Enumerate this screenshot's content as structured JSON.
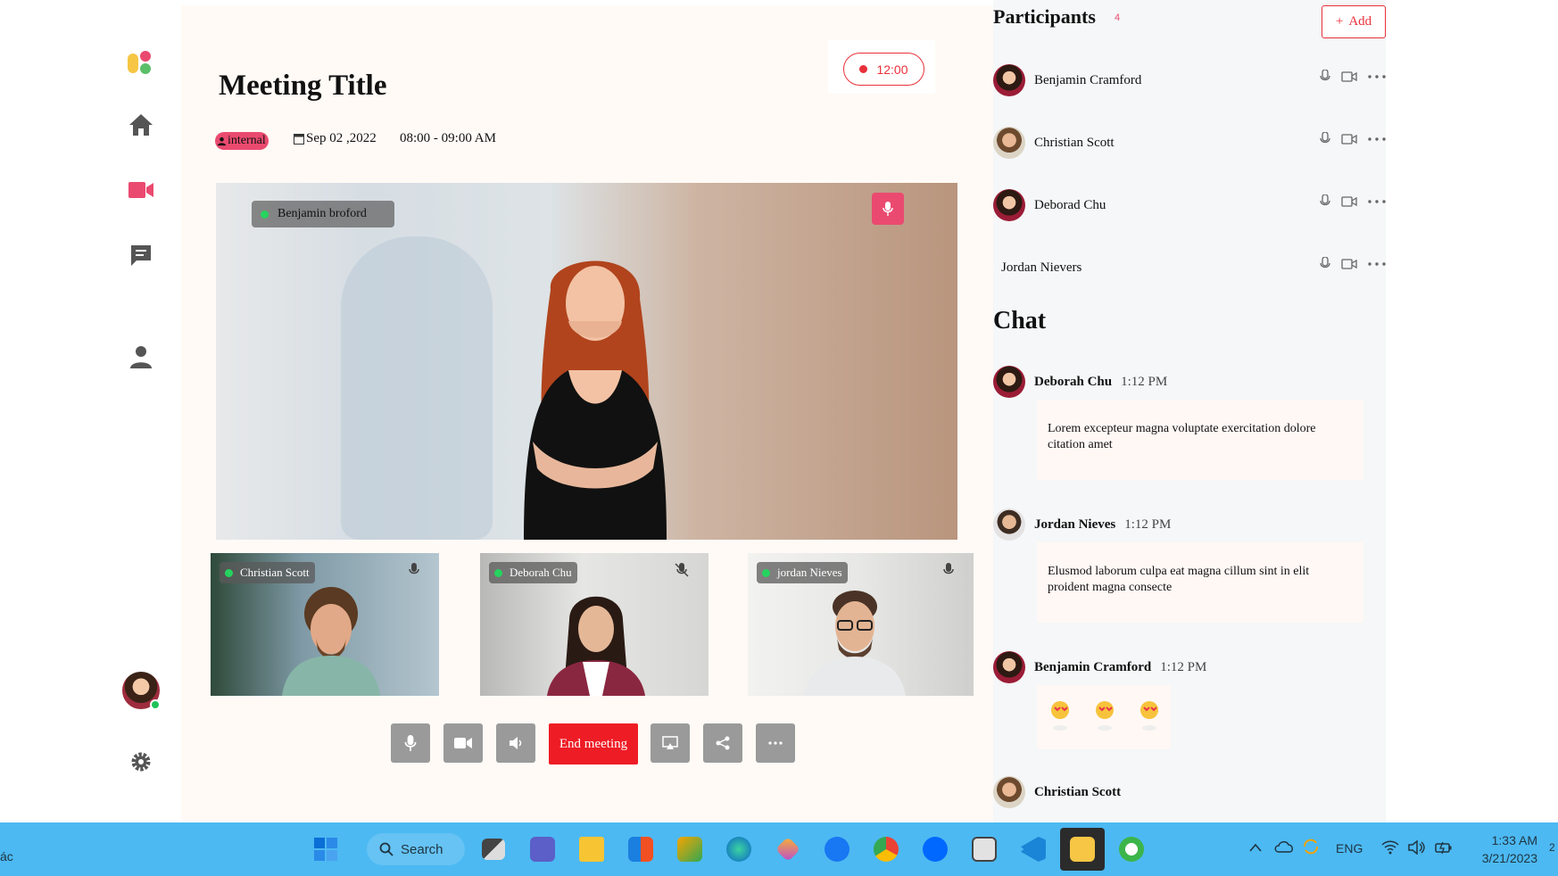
{
  "app": {
    "meeting_title": "Meeting Title",
    "timer": "12:00",
    "tag": "internal",
    "date": "Sep 02 ,2022",
    "time_range": "08:00 - 09:00 AM"
  },
  "colors": {
    "accent": "#ea4a6f",
    "danger": "#ee1c25",
    "taskbar": "#4cb9f2",
    "online": "#26d35e"
  },
  "sidebar": {
    "items": [
      {
        "icon": "home-icon",
        "active": false
      },
      {
        "icon": "video-icon",
        "active": true
      },
      {
        "icon": "chat-icon",
        "active": false
      },
      {
        "icon": "user-icon",
        "active": false
      }
    ],
    "bottom": [
      "avatar",
      "gear-icon"
    ]
  },
  "main_video": {
    "speaker": "Benjamin broford",
    "mic": "mic-icon"
  },
  "thumbnails": [
    {
      "name": "Christian Scott",
      "mic_muted": false
    },
    {
      "name": "Deborah Chu",
      "mic_muted": true
    },
    {
      "name": "jordan Nieves",
      "mic_muted": false
    }
  ],
  "controls": {
    "end_meeting_label": "End meeting",
    "buttons": [
      "mic-icon",
      "camera-icon",
      "speaker-icon",
      "screen-share-icon",
      "share-icon",
      "more-icon"
    ]
  },
  "participants": {
    "title": "Participants",
    "count": "4",
    "add_label": "Add",
    "list": [
      {
        "name": "Benjamin Cramford"
      },
      {
        "name": "Christian Scott"
      },
      {
        "name": "Deborad Chu"
      },
      {
        "name": "Jordan Nievers"
      }
    ]
  },
  "chat": {
    "title": "Chat",
    "messages": [
      {
        "name": "Deborah Chu",
        "time": "1:12 PM",
        "text": "Lorem excepteur magna voluptate exercitation dolore citation amet"
      },
      {
        "name": "Jordan Nieves",
        "time": "1:12 PM",
        "text": "Elusmod laborum culpa eat magna cillum sint in elit proident magna consecte"
      },
      {
        "name": "Benjamin Cramford",
        "time": "1:12 PM",
        "text": ""
      },
      {
        "name": "Christian Scott",
        "time": "",
        "text": ""
      }
    ]
  },
  "taskbar": {
    "left_text": "ác",
    "search_label": "Search",
    "language": "ENG",
    "clock_time": "1:33 AM",
    "clock_date": "3/21/2023",
    "right_edge": "2"
  }
}
